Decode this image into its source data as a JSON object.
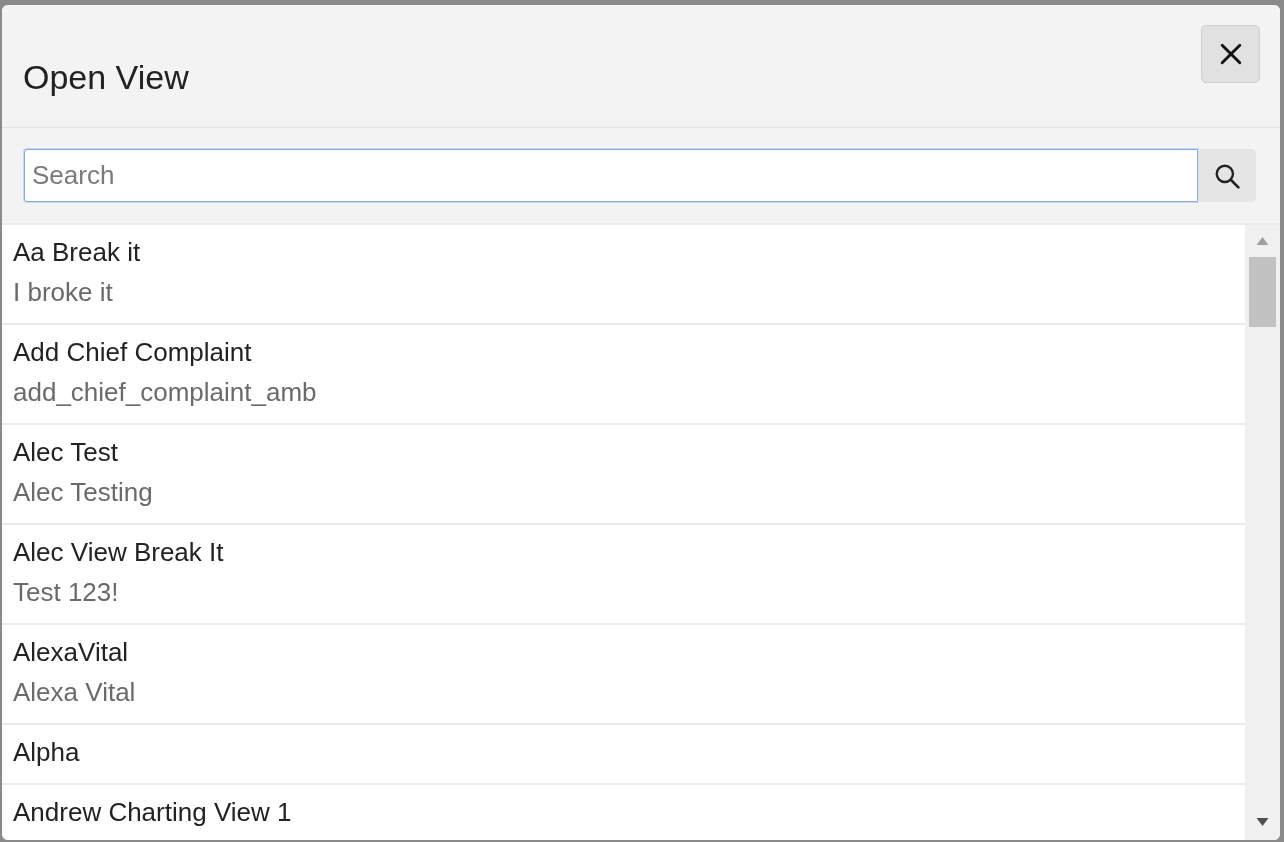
{
  "dialog": {
    "title": "Open View"
  },
  "search": {
    "placeholder": "Search",
    "focused": true
  },
  "items": [
    {
      "title": "Aa Break it",
      "subtitle": "I broke it"
    },
    {
      "title": "Add Chief Complaint",
      "subtitle": "add_chief_complaint_amb"
    },
    {
      "title": "Alec Test",
      "subtitle": "Alec Testing"
    },
    {
      "title": "Alec View Break It",
      "subtitle": "Test 123!"
    },
    {
      "title": "AlexaVital",
      "subtitle": "Alexa Vital"
    },
    {
      "title": "Alpha"
    },
    {
      "title": "Andrew Charting View 1"
    }
  ]
}
